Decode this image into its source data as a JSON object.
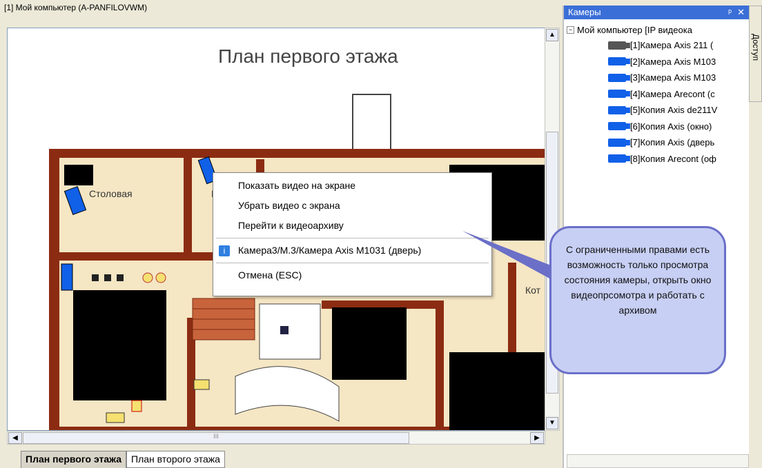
{
  "window_title": "[1] Мой компьютер (A-PANFILOVWM)",
  "map": {
    "title": "План первого этажа",
    "rooms": [
      {
        "name": "dining",
        "label": "Столовая"
      },
      {
        "name": "kitchen-partial",
        "label": "Ку"
      },
      {
        "name": "right-partial",
        "label": "Кот"
      }
    ]
  },
  "context_menu": {
    "items": [
      "Показать видео на экране",
      "Убрать видео с экрана",
      "Перейти к видеоархиву"
    ],
    "info_item": "Камера3/М.3/Камера Axis M1031 (дверь)",
    "cancel": "Отмена (ESC)"
  },
  "callout": "С ограниченными правами  есть возможность только просмотра состояния камеры, открыть окно видеопрсомотра и работать с архивом",
  "tabs": [
    "План первого этажа",
    "План второго этажа"
  ],
  "cam_panel": {
    "title": "Камеры",
    "root": "Мой компьютер [IP видеока",
    "cameras": [
      {
        "label": "[1]Камера Axis 211 (",
        "color": "#555555"
      },
      {
        "label": "[2]Камера Axis M103",
        "color": "#1060e8"
      },
      {
        "label": "[3]Камера Axis M103",
        "color": "#1060e8"
      },
      {
        "label": "[4]Камера Arecont (с",
        "color": "#1060e8"
      },
      {
        "label": "[5]Копия Axis de211V",
        "color": "#1060e8"
      },
      {
        "label": "[6]Копия Axis (окно)",
        "color": "#1060e8"
      },
      {
        "label": "[7]Копия Axis (дверь",
        "color": "#1060e8"
      },
      {
        "label": "[8]Копия Arecont (оф",
        "color": "#1060e8"
      }
    ]
  },
  "side_tab": "Доступ",
  "colors": {
    "wall": "#8b2c12",
    "floor": "#f5e6c4",
    "accent": "#3a6fd8",
    "callout_bg": "#c7cff4"
  }
}
